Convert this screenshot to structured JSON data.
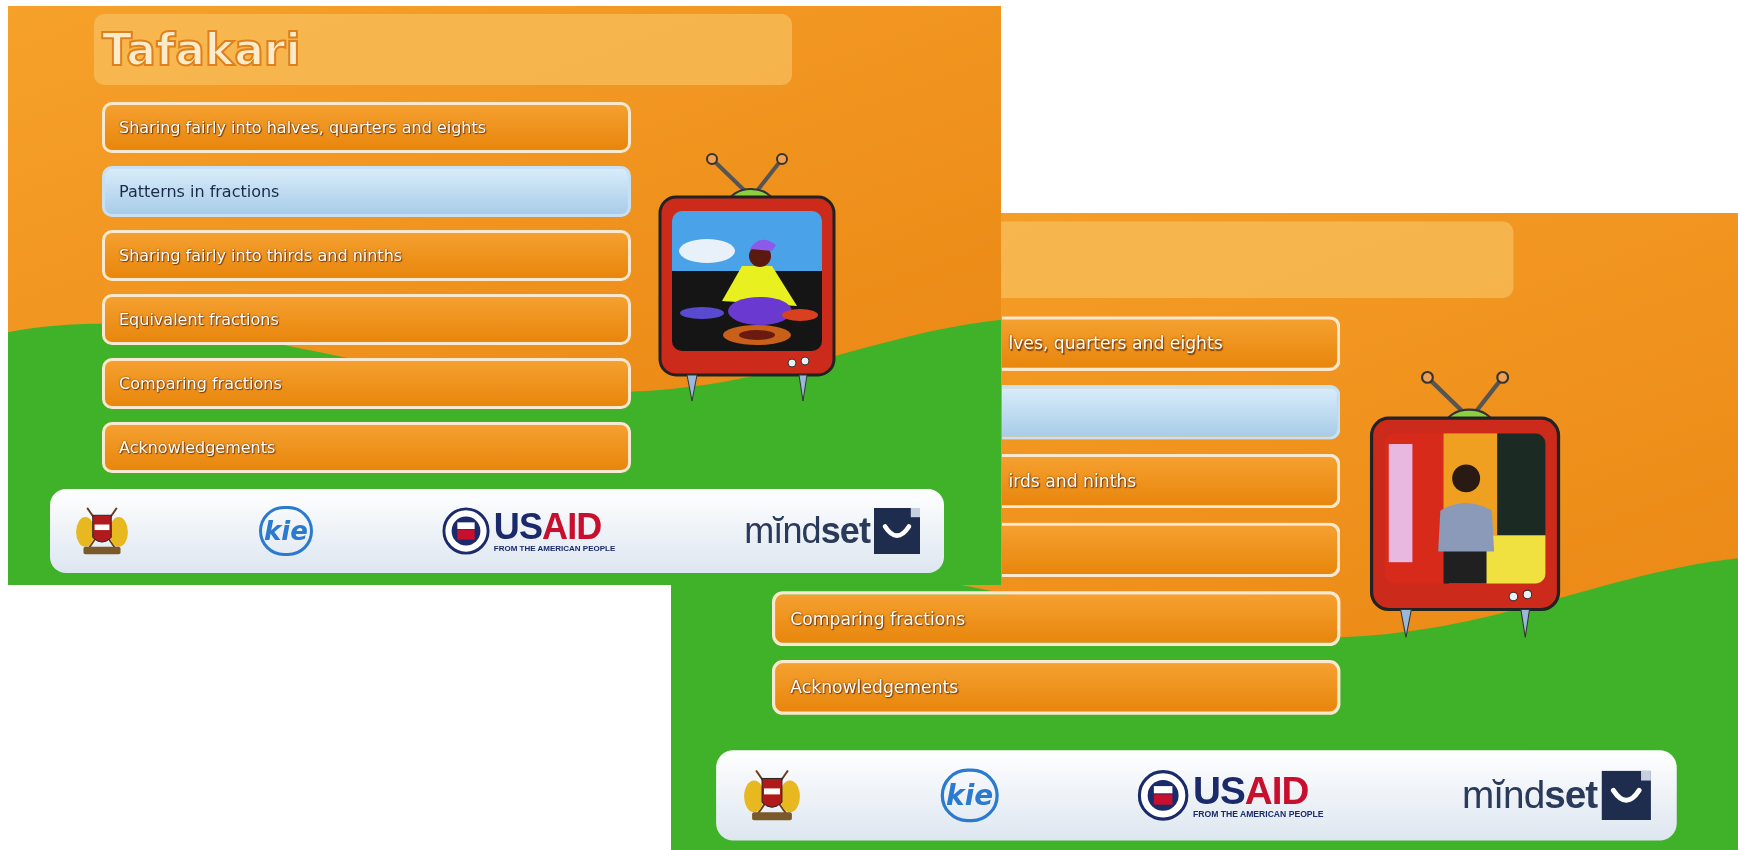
{
  "screens": [
    {
      "title": "Tafakari",
      "menu": [
        {
          "label": "Sharing fairly into halves, quarters and eights",
          "selected": false
        },
        {
          "label": "Patterns in fractions",
          "selected": true
        },
        {
          "label": "Sharing fairly into thirds and ninths",
          "selected": false
        },
        {
          "label": "Equivalent fractions",
          "selected": false
        },
        {
          "label": "Comparing fractions",
          "selected": false
        },
        {
          "label": "Acknowledgements",
          "selected": false
        }
      ],
      "logos": [
        {
          "kind": "coat_of_arms"
        },
        {
          "kind": "kie",
          "text": "kie"
        },
        {
          "kind": "usaid",
          "name": [
            "US",
            "AID"
          ],
          "tagline": "FROM THE AMERICAN PEOPLE"
        },
        {
          "kind": "mindset",
          "text": "mĭnd**set**"
        }
      ]
    },
    {
      "menu": [
        {
          "label": "lves, quarters and eights",
          "selected": false,
          "cut": true
        },
        {
          "selected": true,
          "cut": true
        },
        {
          "label": "irds and ninths",
          "selected": false,
          "cut": true
        },
        {
          "selected": false,
          "cut": true
        },
        {
          "label": "Comparing fractions",
          "selected": false,
          "cut": false
        },
        {
          "label": "Acknowledgements",
          "selected": false,
          "cut": false
        }
      ],
      "logos": [
        {
          "kind": "coat_of_arms"
        },
        {
          "kind": "kie",
          "text": "kie"
        },
        {
          "kind": "usaid",
          "name": [
            "US",
            "AID"
          ],
          "tagline": "FROM THE AMERICAN PEOPLE"
        },
        {
          "kind": "mindset",
          "text": "mĭnd**set**"
        }
      ]
    }
  ]
}
